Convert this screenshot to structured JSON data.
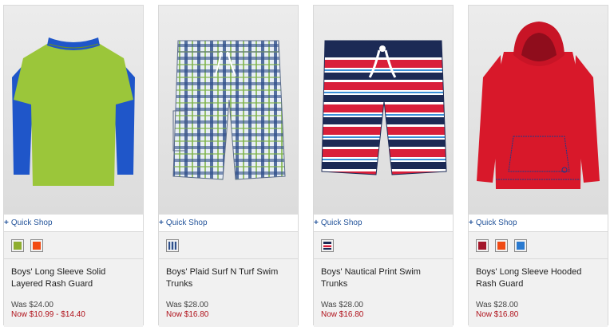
{
  "products": [
    {
      "quick_shop": "Quick Shop",
      "name": "Boys' Long Sleeve Solid Layered Rash Guard",
      "was": "Was $24.00",
      "now": "Now $10.99 - $14.40",
      "image_icon": "long-sleeve-rash-guard-image",
      "swatches": [
        {
          "color": "#8fae2f",
          "label": "green"
        },
        {
          "color": "#f24b13",
          "label": "orange"
        }
      ]
    },
    {
      "quick_shop": "Quick Shop",
      "name": "Boys' Plaid Surf N Turf Swim Trunks",
      "was": "Was $28.00",
      "now": "Now $16.80",
      "image_icon": "plaid-swim-trunks-image",
      "swatches": [
        {
          "color": "#3b5a8c",
          "label": "plaid"
        }
      ]
    },
    {
      "quick_shop": "Quick Shop",
      "name": "Boys' Nautical Print Swim Trunks",
      "was": "Was $28.00",
      "now": "Now $16.80",
      "image_icon": "striped-swim-trunks-image",
      "swatches": [
        {
          "color": "#1c2a55",
          "label": "nautical stripe"
        }
      ]
    },
    {
      "quick_shop": "Quick Shop",
      "name": "Boys' Long Sleeve Hooded Rash Guard",
      "was": "Was $28.00",
      "now": "Now $16.80",
      "image_icon": "hooded-rash-guard-image",
      "swatches": [
        {
          "color": "#a3172b",
          "label": "red"
        },
        {
          "color": "#f04a14",
          "label": "orange"
        },
        {
          "color": "#2a7ad0",
          "label": "blue"
        }
      ]
    }
  ],
  "colors": {
    "link": "#25559b",
    "sale_price": "#b0121b"
  }
}
